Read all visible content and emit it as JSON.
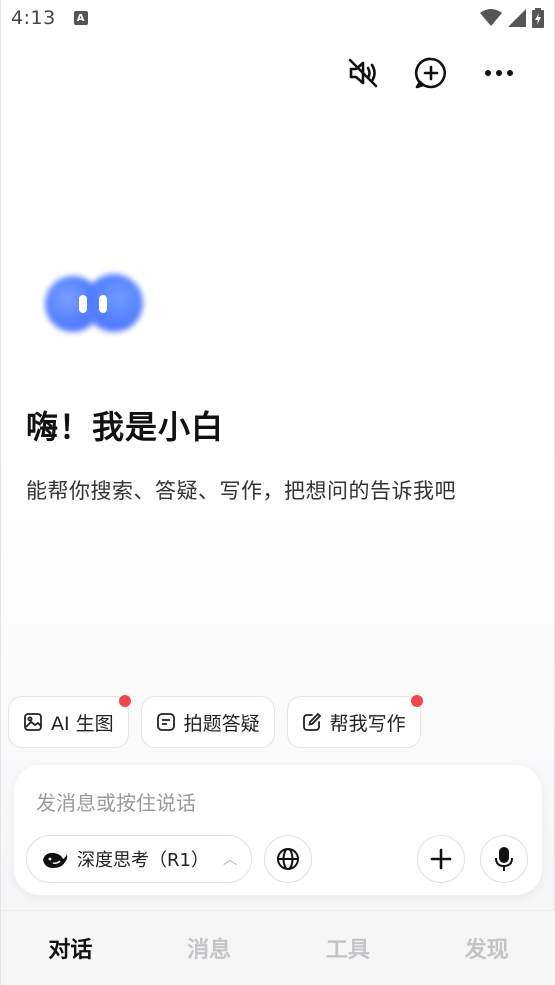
{
  "status_bar": {
    "time": "4:13",
    "notification_icon": "a-icon",
    "icons": [
      "wifi-icon",
      "signal-icon",
      "battery-icon"
    ]
  },
  "top_actions": {
    "icons": [
      "speaker-muted-icon",
      "new-chat-icon",
      "more-icon"
    ]
  },
  "hero": {
    "title": "嗨！我是小白",
    "subtitle": "能帮你搜索、答疑、写作，把想问的告诉我吧"
  },
  "chips": [
    {
      "label": "AI 生图",
      "icon": "image-icon",
      "has_dot": true
    },
    {
      "label": "拍题答疑",
      "icon": "note-icon",
      "has_dot": false
    },
    {
      "label": "帮我写作",
      "icon": "edit-icon",
      "has_dot": true
    }
  ],
  "input": {
    "placeholder": "发消息或按住说话",
    "deep_think_label": "深度思考（R1）",
    "buttons": [
      "globe-icon",
      "plus-icon",
      "mic-icon"
    ]
  },
  "bottom_nav": {
    "items": [
      {
        "label": "对话",
        "active": true
      },
      {
        "label": "消息",
        "active": false
      },
      {
        "label": "工具",
        "active": false
      },
      {
        "label": "发现",
        "active": false
      }
    ]
  },
  "colors": {
    "accent_red": "#f0474b",
    "blob_blue": "#4f7bff",
    "blob_purple": "#8a7cff",
    "inactive_nav": "#c4c4c7"
  }
}
